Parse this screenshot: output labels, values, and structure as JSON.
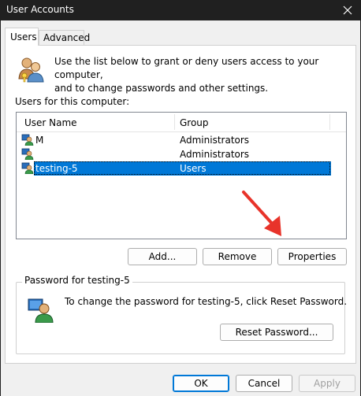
{
  "window": {
    "title": "User Accounts",
    "close_glyph": "✕"
  },
  "tabs": [
    {
      "label": "Users",
      "selected": true
    },
    {
      "label": "Advanced",
      "selected": false
    }
  ],
  "intro": {
    "line1": "Use the list below to grant or deny users access to your computer,",
    "line2": "and to change passwords and other settings."
  },
  "users_list": {
    "label": "Users for this computer:",
    "columns": [
      "User Name",
      "Group"
    ],
    "rows": [
      {
        "name": "M",
        "group": "Administrators",
        "selected": false
      },
      {
        "name": "",
        "group": "Administrators",
        "selected": false
      },
      {
        "name": "testing-5",
        "group": "Users",
        "selected": true
      }
    ]
  },
  "list_buttons": {
    "add": "Add...",
    "remove": "Remove",
    "properties": "Properties"
  },
  "password_group": {
    "legend": "Password for testing-5",
    "text": "To change the password for testing-5, click Reset Password.",
    "reset_button": "Reset Password..."
  },
  "dialog_buttons": {
    "ok": "OK",
    "cancel": "Cancel",
    "apply": "Apply"
  },
  "colors": {
    "selection": "#0078d7",
    "titlebar": "#202020",
    "arrow": "#e8332a"
  }
}
